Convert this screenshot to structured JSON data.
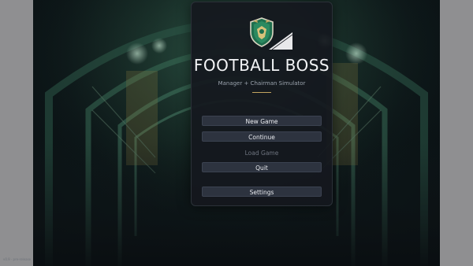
{
  "game": {
    "title": "FOOTBALL BOSS",
    "subtitle": "Manager + Chairman Simulator"
  },
  "menu": {
    "new_game": "New Game",
    "continue": "Continue",
    "load_game": "Load Game",
    "quit": "Quit",
    "settings": "Settings"
  },
  "footer": {
    "version": "v0.9 · pre-release"
  },
  "colors": {
    "accent_gold": "#c2a460",
    "crest_green": "#1f6e4d",
    "button_bg": "#2d333f",
    "panel_bg": "#14181e"
  },
  "icons": {
    "crest": "club-crest-icon"
  }
}
